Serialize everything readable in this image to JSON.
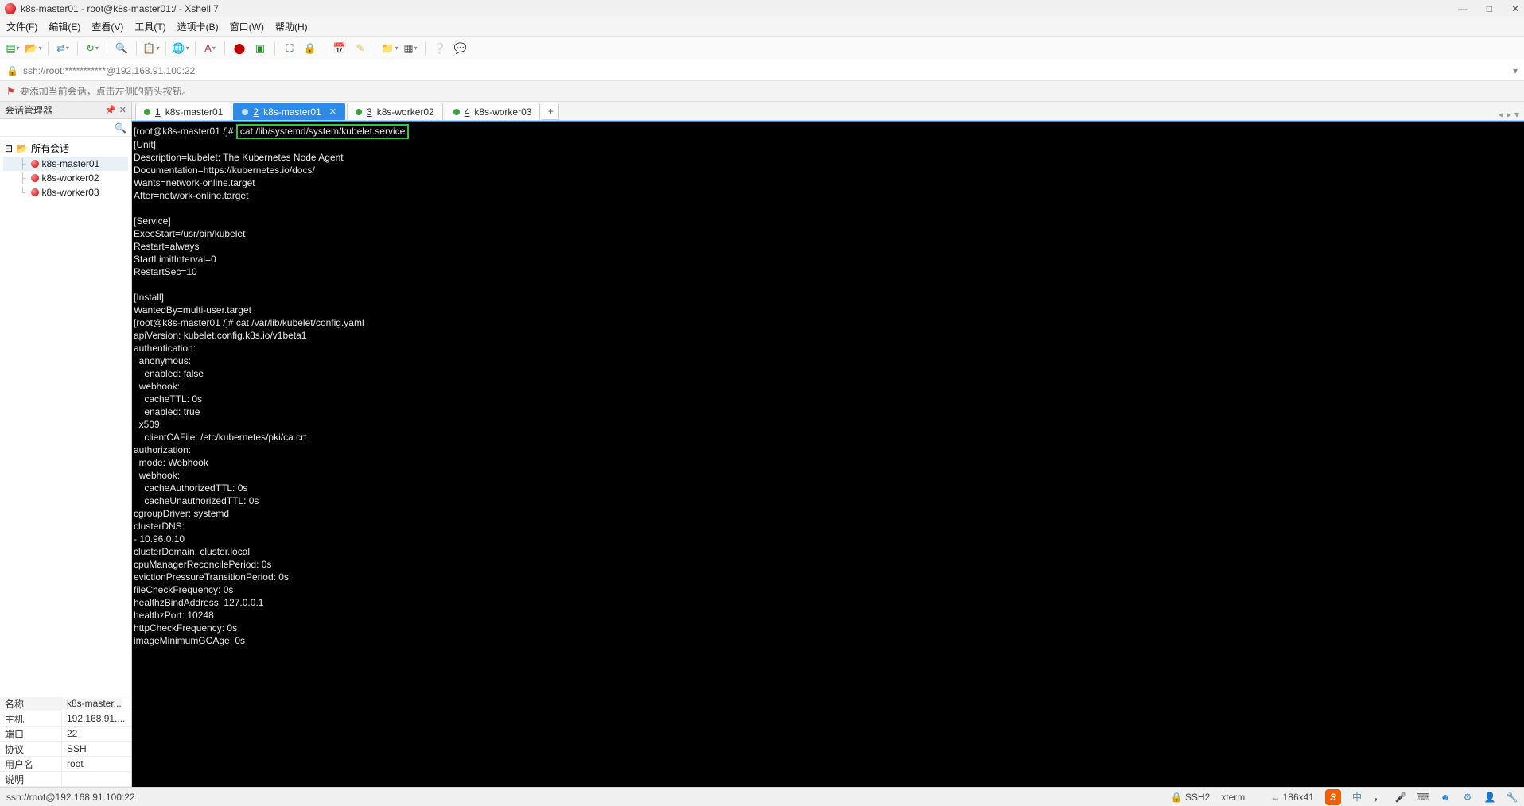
{
  "titlebar": {
    "text": "k8s-master01 - root@k8s-master01:/ - Xshell 7"
  },
  "menu": {
    "file": "文件(F)",
    "edit": "编辑(E)",
    "view": "查看(V)",
    "tools": "工具(T)",
    "tabs": "选项卡(B)",
    "window": "窗口(W)",
    "help": "帮助(H)"
  },
  "addressbar": {
    "text": "ssh://root:***********@192.168.91.100:22"
  },
  "hintbar": {
    "text": "要添加当前会话，点击左侧的箭头按钮。"
  },
  "sidebar": {
    "title": "会话管理器",
    "root": "所有会话",
    "items": [
      {
        "label": "k8s-master01"
      },
      {
        "label": "k8s-worker02"
      },
      {
        "label": "k8s-worker03"
      }
    ]
  },
  "props": {
    "header_key": "名称",
    "header_val": "k8s-master...",
    "rows": [
      {
        "k": "主机",
        "v": "192.168.91...."
      },
      {
        "k": "端口",
        "v": "22"
      },
      {
        "k": "协议",
        "v": "SSH"
      },
      {
        "k": "用户名",
        "v": "root"
      },
      {
        "k": "说明",
        "v": ""
      }
    ]
  },
  "tabs": [
    {
      "num": "1",
      "label": "k8s-master01",
      "active": false
    },
    {
      "num": "2",
      "label": "k8s-master01",
      "active": true
    },
    {
      "num": "3",
      "label": "k8s-worker02",
      "active": false
    },
    {
      "num": "4",
      "label": "k8s-worker03",
      "active": false
    }
  ],
  "terminal": {
    "prompt1": "[root@k8s-master01 /]# ",
    "cmd1": "cat /lib/systemd/system/kubelet.service",
    "block1": "[Unit]\nDescription=kubelet: The Kubernetes Node Agent\nDocumentation=https://kubernetes.io/docs/\nWants=network-online.target\nAfter=network-online.target\n\n[Service]\nExecStart=/usr/bin/kubelet\nRestart=always\nStartLimitInterval=0\nRestartSec=10\n\n[Install]\nWantedBy=multi-user.target",
    "prompt2": "[root@k8s-master01 /]# cat /var/lib/kubelet/config.yaml",
    "block2": "apiVersion: kubelet.config.k8s.io/v1beta1\nauthentication:\n  anonymous:\n    enabled: false\n  webhook:\n    cacheTTL: 0s\n    enabled: true\n  x509:\n    clientCAFile: /etc/kubernetes/pki/ca.crt\nauthorization:\n  mode: Webhook\n  webhook:\n    cacheAuthorizedTTL: 0s\n    cacheUnauthorizedTTL: 0s\ncgroupDriver: systemd\nclusterDNS:\n- 10.96.0.10\nclusterDomain: cluster.local\ncpuManagerReconcilePeriod: 0s\nevictionPressureTransitionPeriod: 0s\nfileCheckFrequency: 0s\nhealthzBindAddress: 127.0.0.1\nhealthzPort: 10248\nhttpCheckFrequency: 0s\nimageMinimumGCAge: 0s"
  },
  "statusbar": {
    "left": "ssh://root@192.168.91.100:22",
    "ssh": "SSH2",
    "term": "xterm",
    "size": "186x41",
    "ime": "中"
  }
}
